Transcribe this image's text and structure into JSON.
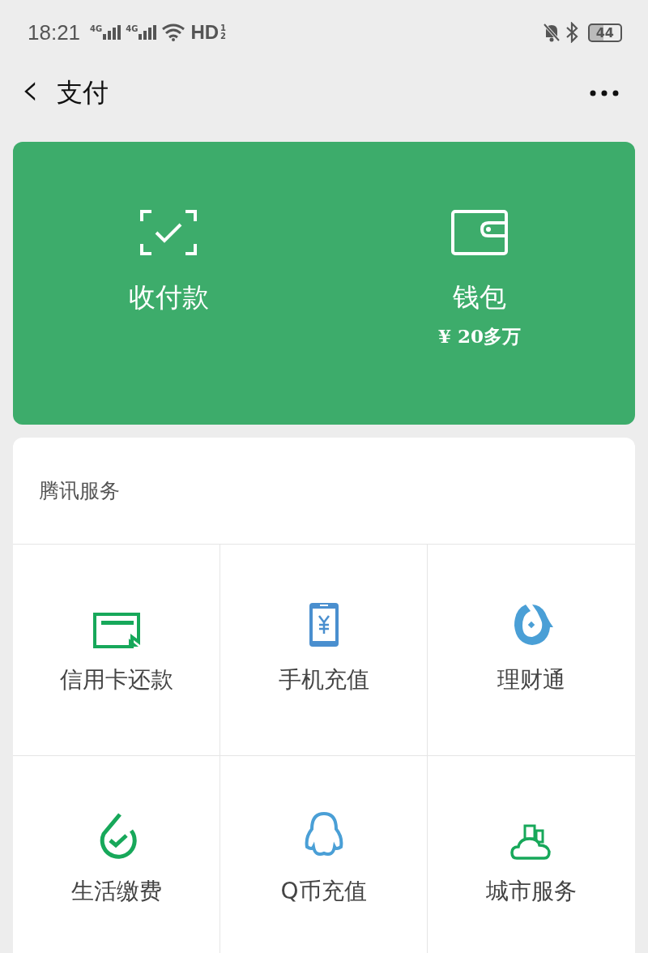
{
  "status_bar": {
    "time": "18:21",
    "networks": [
      "4G",
      "4G"
    ],
    "hd": "HD",
    "sim_marks": [
      "1",
      "2"
    ],
    "battery": "44"
  },
  "nav": {
    "back": "‹",
    "title": "支付"
  },
  "pay_card": {
    "items": [
      {
        "kind": "scan",
        "label": "收付款"
      },
      {
        "kind": "wallet",
        "label": "钱包",
        "amount": "¥ 20多万"
      }
    ]
  },
  "services": {
    "title": "腾讯服务",
    "items": [
      {
        "kind": "card",
        "label": "信用卡还款"
      },
      {
        "kind": "phone",
        "label": "手机充值"
      },
      {
        "kind": "fish",
        "label": "理财通"
      },
      {
        "kind": "bill",
        "label": "生活缴费"
      },
      {
        "kind": "penguin",
        "label": "Q币充值"
      },
      {
        "kind": "city",
        "label": "城市服务"
      }
    ]
  }
}
